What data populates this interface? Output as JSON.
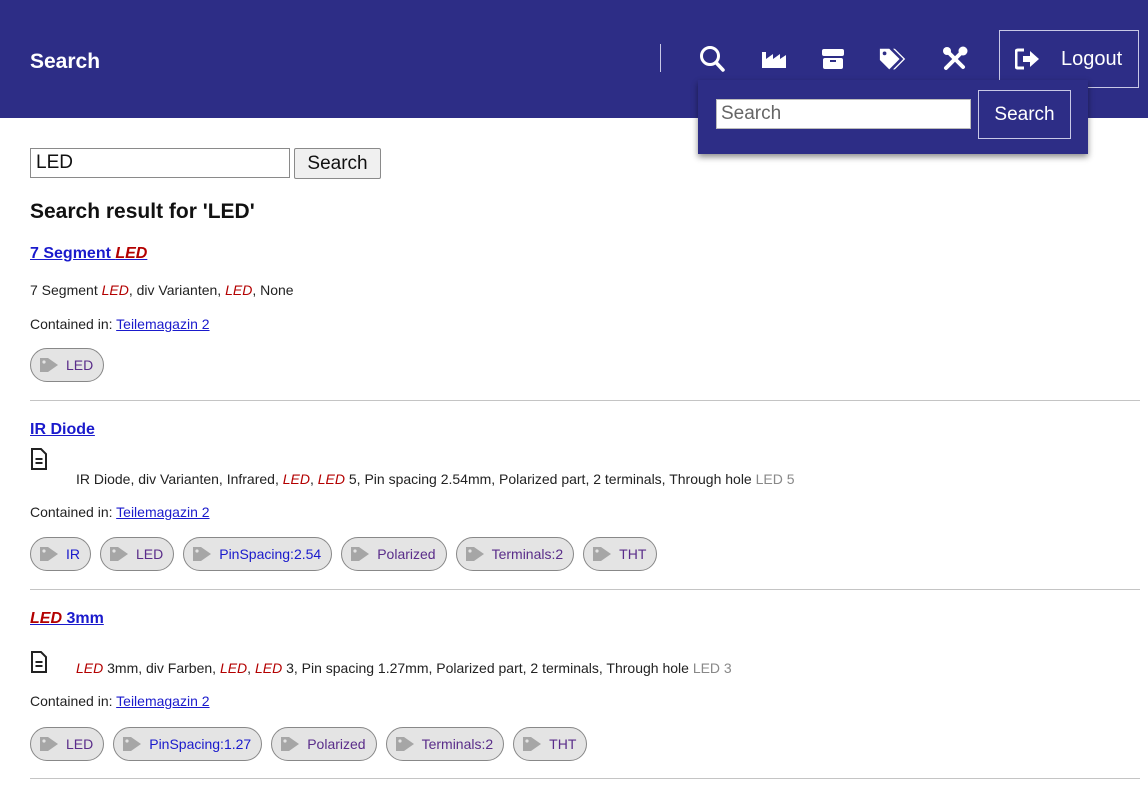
{
  "header": {
    "title": "Search",
    "logout_label": "Logout",
    "icons": [
      "search-icon",
      "factory-icon",
      "box-icon",
      "tags-icon",
      "tools-icon",
      "sign-out-icon"
    ]
  },
  "dropdown": {
    "placeholder": "Search",
    "button_label": "Search"
  },
  "search": {
    "value": "LED",
    "button_label": "Search"
  },
  "heading": "Search result for 'LED'",
  "contained_label": "Contained in:",
  "results": [
    {
      "title_hl": "LED",
      "title_prefix": "7 Segment ",
      "desc": [
        "7 Segment ",
        "LED",
        ", div Varianten, ",
        "LED",
        ", None"
      ],
      "container": "Teilemagazin 2",
      "tags": [
        "LED"
      ]
    },
    {
      "title": "IR Diode",
      "desc": [
        "IR Diode, div Varianten, Infrared, ",
        "LED",
        ", ",
        "LED",
        " 5, Pin spacing 2.54mm, Polarized part, 2 terminals, Through hole ",
        "LED 5"
      ],
      "container": "Teilemagazin 2",
      "tags": [
        "IR",
        "LED",
        "PinSpacing:2.54",
        "Polarized",
        "Terminals:2",
        "THT"
      ]
    },
    {
      "title_hl": "LED",
      "title_suffix": " 3mm",
      "desc": [
        "LED",
        " 3mm, div Farben, ",
        "LED",
        ", ",
        "LED",
        " 3, Pin spacing 1.27mm, Polarized part, 2 terminals, Through hole ",
        "LED 3"
      ],
      "container": "Teilemagazin 2",
      "tags": [
        "LED",
        "PinSpacing:1.27",
        "Polarized",
        "Terminals:2",
        "THT"
      ]
    }
  ],
  "colors": {
    "header_bg": "#2d2d86",
    "link": "#1a1acc",
    "highlight": "#b30000",
    "tag_bg": "#e4e4e4"
  }
}
